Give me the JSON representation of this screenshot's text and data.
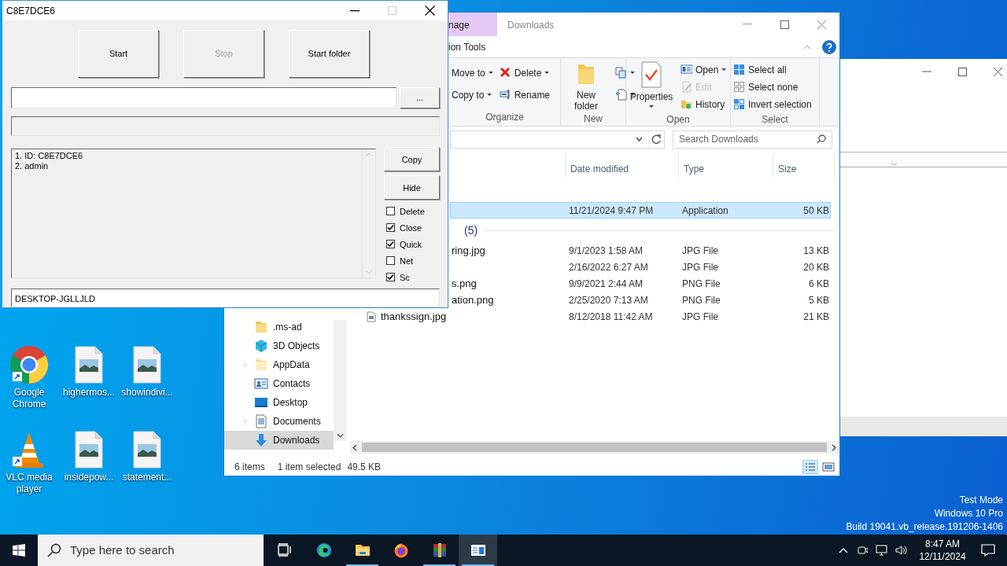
{
  "desktop_icons": [
    {
      "label": "Google Chrome",
      "kind": "chrome",
      "shortcut": true
    },
    {
      "label": "highermos...",
      "kind": "image",
      "shortcut": false
    },
    {
      "label": "showindivi...",
      "kind": "image",
      "shortcut": false
    },
    {
      "label": "VLC media player",
      "kind": "vlc",
      "shortcut": true
    },
    {
      "label": "insidepow...",
      "kind": "image",
      "shortcut": false
    },
    {
      "label": "statement...",
      "kind": "image",
      "shortcut": false
    }
  ],
  "explorer": {
    "title": "Downloads",
    "context_tab": "nage",
    "context_group": "ion Tools",
    "ribbon": [
      {
        "label": "Organize",
        "columns": [
          [
            {
              "label": "Move to",
              "kind": "move",
              "dropdown": true,
              "disabled": false
            },
            {
              "label": "Copy to",
              "kind": "copy",
              "dropdown": true,
              "disabled": false
            }
          ],
          [
            {
              "label": "Delete",
              "kind": "delete",
              "dropdown": true,
              "disabled": false
            },
            {
              "label": "Rename",
              "kind": "rename",
              "dropdown": false,
              "disabled": false
            }
          ]
        ]
      },
      {
        "label": "New",
        "columns": [
          [
            {
              "label": "New folder",
              "kind": "new_folder",
              "dropdown": false,
              "disabled": false
            }
          ],
          [
            {
              "kind": "new_item",
              "dropdown": true,
              "disabled": false
            },
            {
              "kind": "easy_access",
              "dropdown": true,
              "disabled": false
            }
          ]
        ]
      },
      {
        "label": "Open",
        "columns": [
          [
            {
              "label": "Properties",
              "kind": "properties",
              "dropdown": true,
              "disabled": false
            }
          ],
          [
            {
              "label": "Open",
              "kind": "open",
              "dropdown": true,
              "disabled": false
            },
            {
              "label": "Edit",
              "kind": "edit",
              "dropdown": false,
              "disabled": true
            },
            {
              "label": "History",
              "kind": "history",
              "dropdown": false,
              "disabled": false
            }
          ]
        ]
      },
      {
        "label": "Select",
        "columns": [
          [
            {
              "label": "Select all",
              "kind": "select_all",
              "dropdown": false,
              "disabled": false
            },
            {
              "label": "Select none",
              "kind": "select_none",
              "dropdown": false,
              "disabled": false
            },
            {
              "label": "Invert selection",
              "kind": "invert",
              "dropdown": false,
              "disabled": false
            }
          ]
        ]
      }
    ],
    "search": {
      "placeholder": "Search Downloads"
    },
    "columns": [
      "Date modified",
      "Type",
      "Size"
    ],
    "nav": [
      {
        "label": ".ms-ad",
        "kind": "folder",
        "expandable": false,
        "selected": false
      },
      {
        "label": "3D Objects",
        "kind": "objects",
        "expandable": false,
        "selected": false
      },
      {
        "label": "AppData",
        "kind": "folder_light",
        "expandable": true,
        "selected": false
      },
      {
        "label": "Contacts",
        "kind": "contacts",
        "expandable": false,
        "selected": false
      },
      {
        "label": "Desktop",
        "kind": "desktop",
        "expandable": false,
        "selected": false
      },
      {
        "label": "Documents",
        "kind": "documents",
        "expandable": true,
        "selected": false
      },
      {
        "label": "Downloads",
        "kind": "downloads",
        "expandable": false,
        "selected": true
      }
    ],
    "rows": [
      {
        "kind": "file",
        "date": "11/21/2024 9:47 PM",
        "type": "Application",
        "size": "50 KB",
        "selected": true
      },
      {
        "kind": "group",
        "label": "(5)"
      },
      {
        "kind": "file",
        "name": "ring.jpg",
        "date": "9/1/2023 1:58 AM",
        "type": "JPG File",
        "size": "13 KB",
        "selected": false
      },
      {
        "kind": "file",
        "date": "2/16/2022 6:27 AM",
        "type": "JPG File",
        "size": "20 KB",
        "selected": false
      },
      {
        "kind": "file",
        "name": "s.png",
        "date": "9/9/2021 2:44 AM",
        "type": "PNG File",
        "size": "6 KB",
        "selected": false
      },
      {
        "kind": "file",
        "name": "ation.png",
        "date": "2/25/2020 7:13 AM",
        "type": "PNG File",
        "size": "5 KB",
        "selected": false
      },
      {
        "kind": "file_full",
        "name": "thankssign.jpg",
        "date": "8/12/2018 11:42 AM",
        "type": "JPG File",
        "size": "21 KB",
        "selected": false
      }
    ],
    "status": {
      "count": "6 items",
      "selection": "1 item selected",
      "size": "49.5 KB"
    }
  },
  "tool_window": {
    "title": "C8E7DCE6",
    "top_buttons": [
      {
        "label": "Start",
        "disabled": false
      },
      {
        "label": "Stop",
        "disabled": true
      },
      {
        "label": "Start folder",
        "disabled": false
      }
    ],
    "browse_button": "...",
    "log": [
      "1. ID: C8E7DCE6",
      "2. admin"
    ],
    "side_buttons": [
      "Copy",
      "Hide"
    ],
    "options": [
      {
        "label": "Delete",
        "checked": false
      },
      {
        "label": "Close",
        "checked": true
      },
      {
        "label": "Quick",
        "checked": true
      },
      {
        "label": "Net",
        "checked": false
      },
      {
        "label": "Sc",
        "checked": true
      }
    ],
    "computer_name": "DESKTOP-JGLLJLD"
  },
  "system_notice": [
    "Test Mode",
    "Windows 10 Pro",
    "Build 19041.vb_release.191206-1406"
  ],
  "taskbar": {
    "search_placeholder": "Type here to search",
    "apps": [
      {
        "kind": "taskview",
        "running": false,
        "active": false
      },
      {
        "kind": "edge",
        "running": false,
        "active": false
      },
      {
        "kind": "explorer",
        "running": true,
        "active": false
      },
      {
        "kind": "firefox",
        "running": false,
        "active": false
      },
      {
        "kind": "winrar",
        "running": true,
        "active": false
      },
      {
        "kind": "window_app",
        "running": true,
        "active": true
      }
    ],
    "time": "8:47 AM",
    "date": "12/11/2024"
  }
}
